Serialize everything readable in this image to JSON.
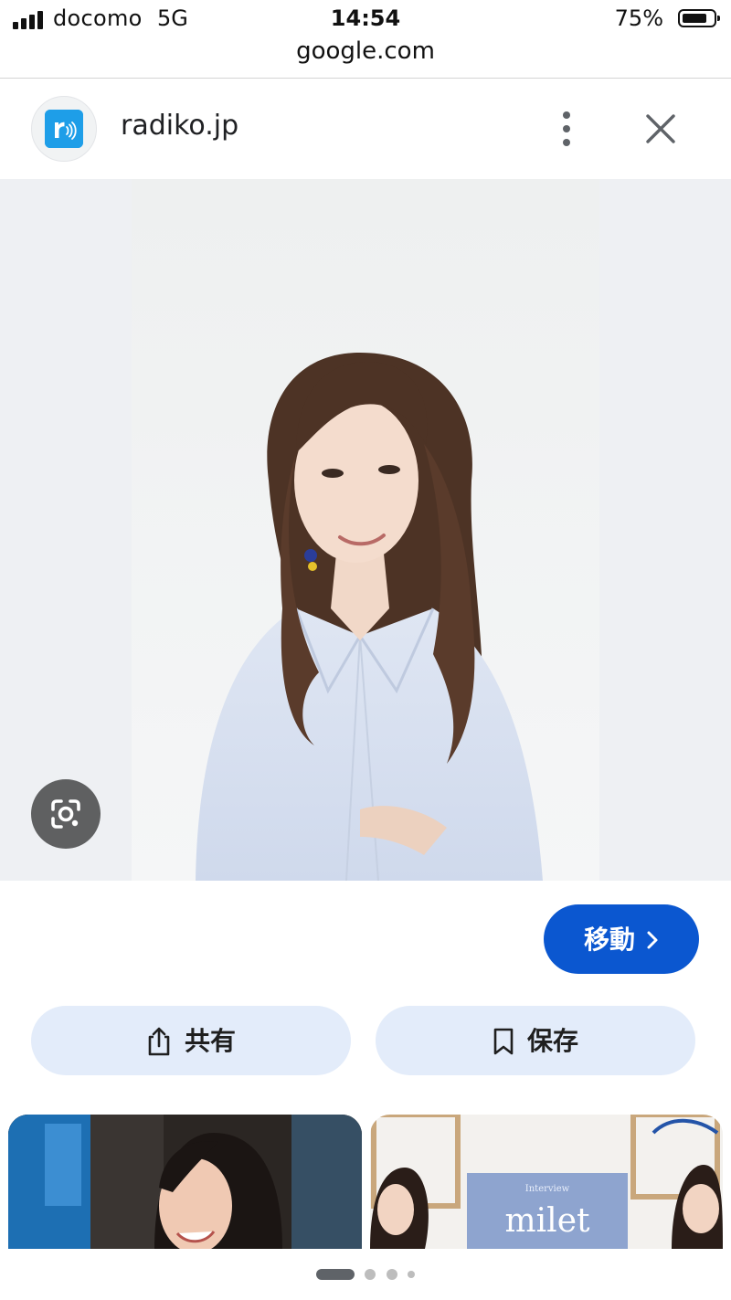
{
  "status_bar": {
    "carrier": "docomo",
    "network": "5G",
    "time": "14:54",
    "battery_percent": "75%",
    "battery_level": 0.75,
    "signal_bars": 4
  },
  "browser": {
    "url": "google.com"
  },
  "source": {
    "name": "radiko.jp",
    "favicon_icon": "radiko-logo-icon",
    "favicon_color": "#1e9ee8"
  },
  "actions": {
    "visit_label": "移動",
    "share_label": "共有",
    "save_label": "保存"
  },
  "related": {
    "card2_title": "milet",
    "card2_caption": "Interview"
  },
  "pagination": {
    "active_index": 0,
    "count": 4
  },
  "colors": {
    "accent": "#0b57d0",
    "action_bg": "#e3ecfa"
  }
}
